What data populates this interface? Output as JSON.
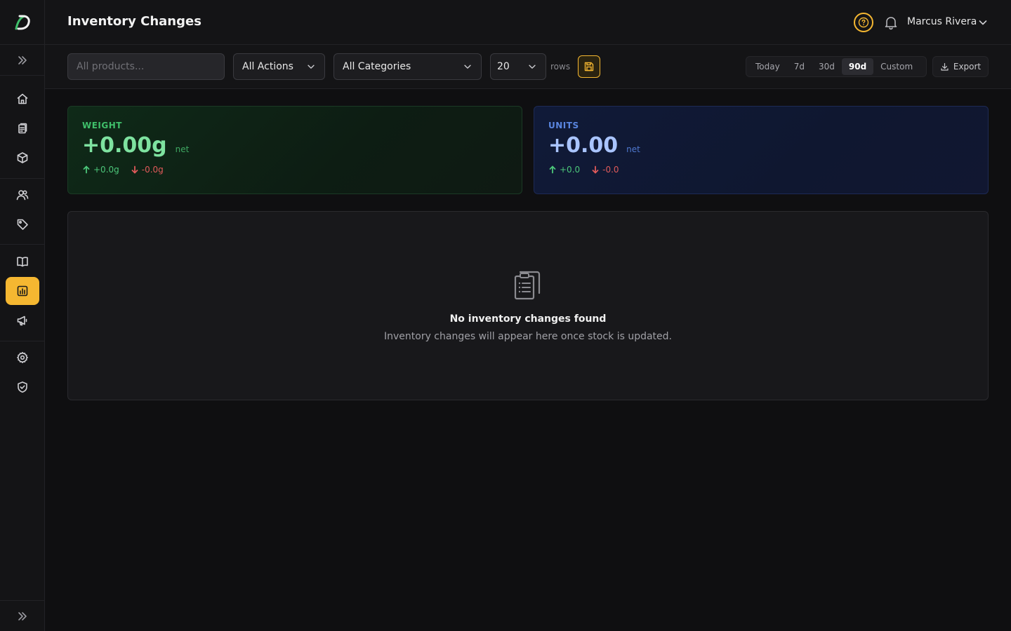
{
  "app": {
    "logo_letter": "D",
    "accent_color": "#f5b731"
  },
  "header": {
    "title": "Inventory Changes",
    "user_name": "Marcus Rivera"
  },
  "sidebar": {
    "items": [
      {
        "name": "home",
        "icon": "home-icon"
      },
      {
        "name": "orders",
        "icon": "clipboard-icon"
      },
      {
        "name": "products",
        "icon": "box-icon"
      },
      {
        "name": "customers",
        "icon": "users-icon"
      },
      {
        "name": "tags",
        "icon": "tag-icon"
      },
      {
        "name": "catalog",
        "icon": "book-icon"
      },
      {
        "name": "reports",
        "icon": "bar-chart-icon",
        "active": true
      },
      {
        "name": "marketing",
        "icon": "megaphone-icon"
      },
      {
        "name": "settings",
        "icon": "gear-icon"
      },
      {
        "name": "security",
        "icon": "shield-check-icon"
      }
    ]
  },
  "toolbar": {
    "search_placeholder": "All products...",
    "actions_value": "All Actions",
    "categories_value": "All Categories",
    "rows_value": "20",
    "rows_label": "rows",
    "ranges": [
      "Today",
      "7d",
      "30d",
      "90d",
      "Custom"
    ],
    "active_range": "90d",
    "export_label": "Export"
  },
  "cards": {
    "weight": {
      "label": "WEIGHT",
      "value": "+0.00g",
      "net_label": "net",
      "up": "+0.0g",
      "down": "-0.0g",
      "label_color": "#3fbf6a",
      "value_color": "#7ee2a0"
    },
    "units": {
      "label": "UNITS",
      "value": "+0.00",
      "net_label": "net",
      "up": "+0.0",
      "down": "-0.0",
      "label_color": "#5a86e0",
      "value_color": "#a9c4ff"
    }
  },
  "empty_state": {
    "title": "No inventory changes found",
    "subtitle": "Inventory changes will appear here once stock is updated."
  }
}
